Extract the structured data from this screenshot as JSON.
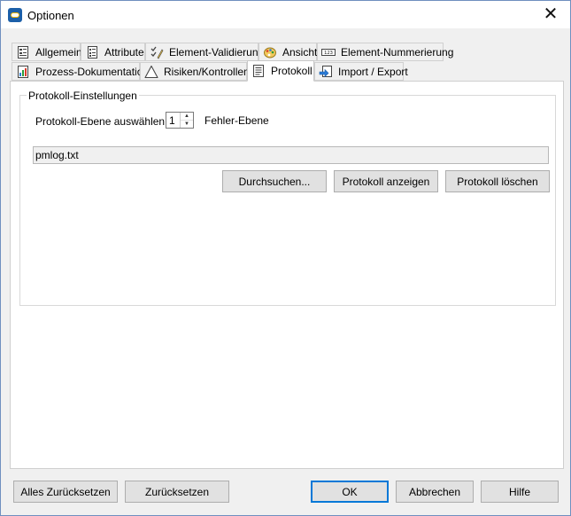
{
  "window": {
    "title": "Optionen",
    "close_glyph": "✕"
  },
  "tabs": {
    "row1": [
      {
        "label": "Allgemein",
        "icon": "document-list-icon"
      },
      {
        "label": "Attribute",
        "icon": "attribute-list-icon"
      },
      {
        "label": "Element-Validierung",
        "icon": "checklist-pen-icon"
      },
      {
        "label": "Ansicht",
        "icon": "palette-icon"
      },
      {
        "label": "Element-Nummerierung",
        "icon": "numbering-icon"
      }
    ],
    "row2": [
      {
        "label": "Prozess-Dokumentation",
        "icon": "process-doc-icon"
      },
      {
        "label": "Risiken/Kontrollen",
        "icon": "warning-triangle-icon"
      },
      {
        "label": "Protokoll",
        "icon": "log-document-icon",
        "active": true
      },
      {
        "label": "Import / Export",
        "icon": "import-export-icon"
      }
    ]
  },
  "protokoll": {
    "group_title": "Protokoll-Einstellungen",
    "level_label": "Protokoll-Ebene auswählen",
    "level_value": "1",
    "level_description": "Fehler-Ebene",
    "file_value": "pmlog.txt",
    "buttons": {
      "browse": "Durchsuchen...",
      "show": "Protokoll anzeigen",
      "delete": "Protokoll löschen"
    }
  },
  "footer": {
    "reset_all": "Alles Zurücksetzen",
    "reset": "Zurücksetzen",
    "ok": "OK",
    "cancel": "Abbrechen",
    "help": "Hilfe"
  }
}
